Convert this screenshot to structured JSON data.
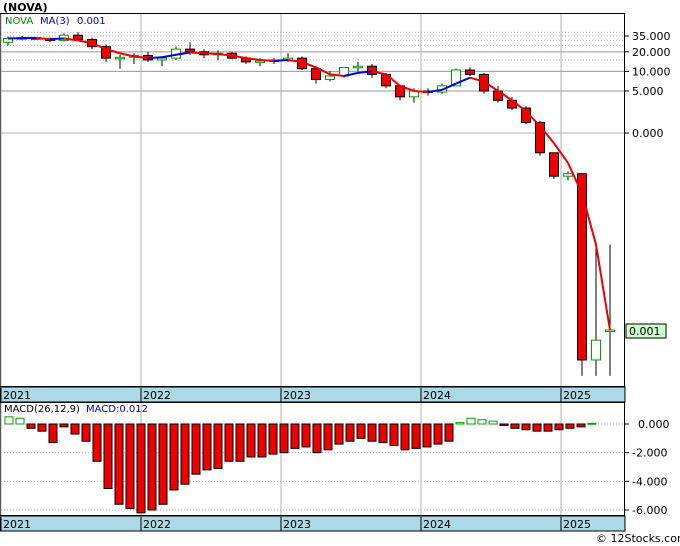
{
  "title": "(NOVA)",
  "legend": {
    "ticker": "NOVA",
    "ma_label": "MA(3)",
    "ma_value": "0.001",
    "macd_label": "MACD(26,12,9)",
    "macd_value_label": "MACD:0.012"
  },
  "price_tag": "0.001",
  "watermark": "© 12Stocks.com",
  "colors": {
    "up": "#00a000",
    "down": "#ee0000",
    "ma_up": "#0000cc",
    "ma_down": "#ee0000",
    "axis_band": "#add8e6",
    "grid": "#b0b0b0",
    "price_tag_bg": "#ccffcc"
  },
  "chart_data": [
    {
      "type": "candlestick",
      "panel": "price",
      "scale": "log",
      "y_ticks": [
        "35.000",
        "20.000",
        "10.000",
        "5.000",
        "0.000",
        "0.001"
      ],
      "y_tick_values": [
        35,
        20,
        10,
        5,
        1,
        0.001
      ],
      "x_ticks": [
        "2021",
        "2022",
        "2023",
        "2024",
        "2025"
      ],
      "x_tick_index": [
        0,
        10,
        20,
        30,
        40
      ],
      "candles": [
        {
          "o": 28,
          "h": 34,
          "l": 25,
          "c": 32
        },
        {
          "o": 32,
          "h": 35,
          "l": 30,
          "c": 33
        },
        {
          "o": 33,
          "h": 34,
          "l": 31,
          "c": 32
        },
        {
          "o": 32,
          "h": 33,
          "l": 28,
          "c": 30
        },
        {
          "o": 30,
          "h": 38,
          "l": 29,
          "c": 36
        },
        {
          "o": 36,
          "h": 40,
          "l": 30,
          "c": 31
        },
        {
          "o": 31,
          "h": 33,
          "l": 22,
          "c": 24
        },
        {
          "o": 24,
          "h": 26,
          "l": 14,
          "c": 16
        },
        {
          "o": 16,
          "h": 18,
          "l": 11,
          "c": 16.5
        },
        {
          "o": 16.5,
          "h": 19,
          "l": 13,
          "c": 17.5
        },
        {
          "o": 17.5,
          "h": 20,
          "l": 14,
          "c": 15
        },
        {
          "o": 15,
          "h": 17,
          "l": 12,
          "c": 16
        },
        {
          "o": 16,
          "h": 24,
          "l": 15,
          "c": 22
        },
        {
          "o": 22,
          "h": 28,
          "l": 18,
          "c": 20
        },
        {
          "o": 20,
          "h": 22,
          "l": 16,
          "c": 18
        },
        {
          "o": 18,
          "h": 21,
          "l": 15,
          "c": 19
        },
        {
          "o": 19,
          "h": 20,
          "l": 15.5,
          "c": 16
        },
        {
          "o": 16,
          "h": 17,
          "l": 13,
          "c": 14
        },
        {
          "o": 14,
          "h": 16,
          "l": 12,
          "c": 14.5
        },
        {
          "o": 14.5,
          "h": 16,
          "l": 13,
          "c": 15
        },
        {
          "o": 15,
          "h": 19,
          "l": 14,
          "c": 16
        },
        {
          "o": 16,
          "h": 17,
          "l": 10.5,
          "c": 11
        },
        {
          "o": 11,
          "h": 12,
          "l": 6.5,
          "c": 7.5
        },
        {
          "o": 7.5,
          "h": 10,
          "l": 7,
          "c": 8.5
        },
        {
          "o": 8.5,
          "h": 11,
          "l": 8,
          "c": 11.5
        },
        {
          "o": 11.5,
          "h": 14,
          "l": 10,
          "c": 12
        },
        {
          "o": 12,
          "h": 13,
          "l": 8,
          "c": 9
        },
        {
          "o": 9,
          "h": 9.5,
          "l": 5.5,
          "c": 6
        },
        {
          "o": 6,
          "h": 6.3,
          "l": 3.5,
          "c": 4
        },
        {
          "o": 4,
          "h": 5.5,
          "l": 3.2,
          "c": 5
        },
        {
          "o": 5,
          "h": 5.5,
          "l": 4.2,
          "c": 4.8
        },
        {
          "o": 4.8,
          "h": 6.5,
          "l": 4.5,
          "c": 6
        },
        {
          "o": 6,
          "h": 11,
          "l": 6,
          "c": 10.5
        },
        {
          "o": 10.5,
          "h": 11.5,
          "l": 8.5,
          "c": 9
        },
        {
          "o": 9,
          "h": 9.5,
          "l": 4.5,
          "c": 5
        },
        {
          "o": 5,
          "h": 6,
          "l": 3.2,
          "c": 3.5
        },
        {
          "o": 3.5,
          "h": 4,
          "l": 2.4,
          "c": 2.6
        },
        {
          "o": 2.6,
          "h": 2.8,
          "l": 1.4,
          "c": 1.5
        },
        {
          "o": 1.5,
          "h": 1.6,
          "l": 0.45,
          "c": 0.5
        },
        {
          "o": 0.5,
          "h": 0.5,
          "l": 0.2,
          "c": 0.22
        },
        {
          "o": 0.22,
          "h": 0.26,
          "l": 0.19,
          "c": 0.24
        },
        {
          "o": 0.24,
          "h": 0.24,
          "l": 0.0002,
          "c": 0.00035
        },
        {
          "o": 0.00035,
          "h": 0.02,
          "l": 0.0002,
          "c": 0.0007
        },
        {
          "o": 0.001,
          "h": 0.02,
          "l": 0.0002,
          "c": 0.001
        }
      ],
      "ma3": [
        32,
        32.5,
        32.5,
        31.5,
        32,
        30,
        27,
        22,
        19,
        17,
        16,
        16.5,
        18,
        19.5,
        19,
        18.5,
        17.5,
        16,
        15,
        14.5,
        15,
        14,
        11.5,
        9,
        8.5,
        9.5,
        10,
        9,
        6,
        5,
        4.8,
        5.2,
        6.5,
        8,
        7,
        5,
        3.5,
        2.3,
        1.3,
        0.7,
        0.35,
        0.12,
        0.02,
        0.001
      ]
    },
    {
      "type": "bar",
      "panel": "macd",
      "y_ticks": [
        "0.000",
        "-2.000",
        "-4.000",
        "-6.000"
      ],
      "y_tick_values": [
        0,
        -2,
        -4,
        -6
      ],
      "ylim": [
        -6.3,
        0.8
      ],
      "x_ticks": [
        "2021",
        "2022",
        "2023",
        "2024",
        "2025"
      ],
      "values": [
        0.5,
        0.4,
        -0.3,
        -0.5,
        -1.3,
        -0.2,
        -0.7,
        -1.2,
        -2.6,
        -4.5,
        -5.6,
        -5.9,
        -6.2,
        -6.0,
        -5.6,
        -4.6,
        -4.2,
        -3.5,
        -3.2,
        -3.1,
        -2.6,
        -2.6,
        -2.3,
        -2.3,
        -2.1,
        -2.0,
        -1.7,
        -1.6,
        -2.0,
        -1.8,
        -1.4,
        -1.2,
        -1.0,
        -1.2,
        -1.3,
        -1.5,
        -1.8,
        -1.7,
        -1.6,
        -1.4,
        -1.2,
        0.1,
        0.4,
        0.3,
        0.2,
        -0.1,
        -0.3,
        -0.4,
        -0.5,
        -0.5,
        -0.4,
        -0.3,
        -0.2,
        0.05
      ]
    }
  ]
}
